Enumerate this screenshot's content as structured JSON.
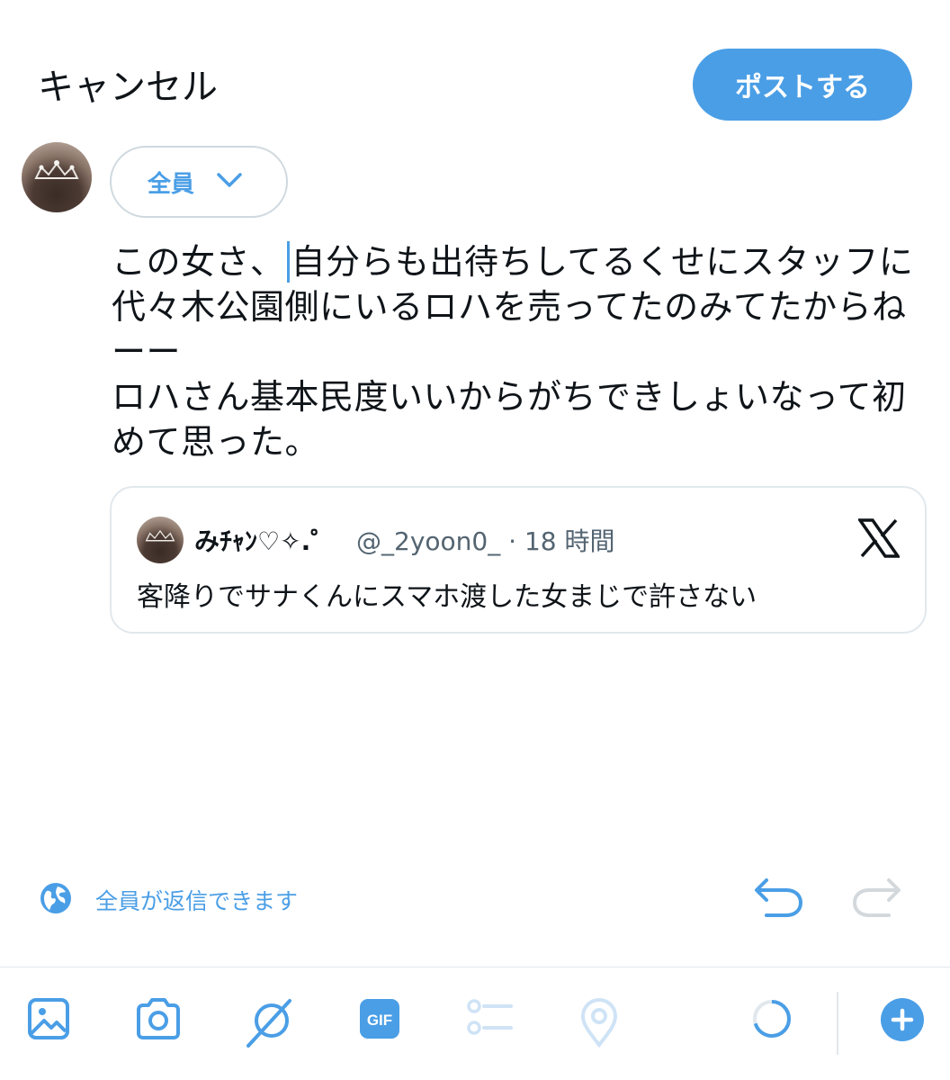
{
  "header": {
    "cancel_label": "キャンセル",
    "post_label": "ポストする"
  },
  "audience": {
    "label": "全員",
    "icon": "chevron-down-icon"
  },
  "composer": {
    "text_before_cursor": "この女さ、",
    "text_after_cursor": "自分らも出待ちしてるくせにスタッフに代々木公園側にいるロハを売ってたのみてたからねーー\nロハさん基本民度いいからがちできしょいなって初めて思った。"
  },
  "quoted_post": {
    "display_name": "みﾁｬﾝ♡✧.゜",
    "handle": "@_2yoon0_",
    "separator": "·",
    "time": "18 時間",
    "text": "客降りでサナくんにスマホ渡した女まじで許さない",
    "source_icon": "x-logo-icon"
  },
  "reply_setting": {
    "label": "全員が返信できます",
    "icon": "globe-icon"
  },
  "toolbar": {
    "icons": [
      "image-icon",
      "camera-icon",
      "grok-icon",
      "gif-icon",
      "poll-icon",
      "location-icon",
      "char-count-ring-icon",
      "add-post-icon"
    ],
    "gif_label": "GIF"
  },
  "colors": {
    "accent": "#4a9ee6",
    "text": "#0f1419",
    "secondary_text": "#536471",
    "border": "#cfd9de",
    "disabled": "#cfe3f6"
  }
}
